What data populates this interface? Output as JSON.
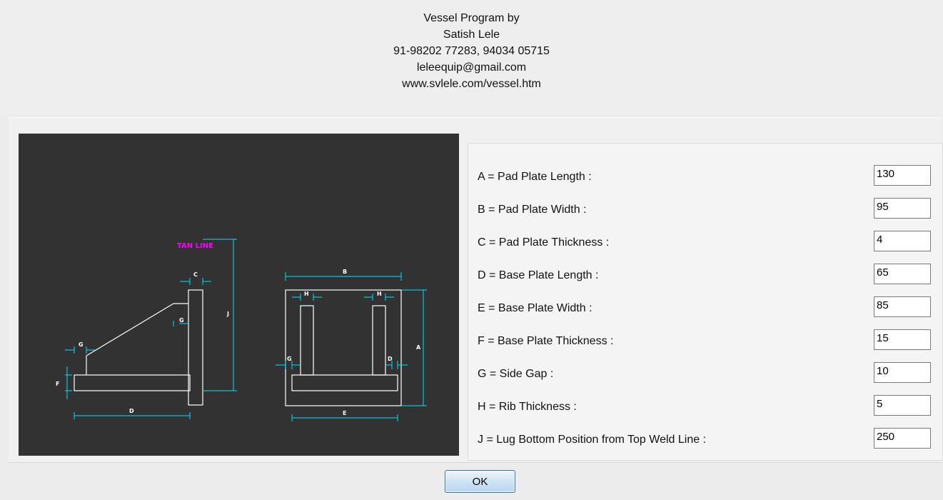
{
  "header": {
    "lines": [
      "Vessel Program by",
      "Satish Lele",
      "91-98202 77283, 94034 05715",
      "leleequip@gmail.com",
      "www.svlele.com/vessel.htm"
    ]
  },
  "drawing": {
    "tan_line_label": "TAN LINE",
    "dim_labels": {
      "A": "A",
      "B": "B",
      "C": "C",
      "D": "D",
      "E": "E",
      "F": "F",
      "G": "G",
      "H": "H",
      "J": "J"
    },
    "colors": {
      "background": "#323232",
      "outline": "#ffffff",
      "dimension": "#00e0ff",
      "tan_line": "#ff00ff"
    }
  },
  "parameters": [
    {
      "label": "A = Pad Plate Length :",
      "value": "130"
    },
    {
      "label": "B = Pad Plate Width :",
      "value": "95"
    },
    {
      "label": "C = Pad Plate Thickness :",
      "value": "4"
    },
    {
      "label": "D = Base Plate Length :",
      "value": "65"
    },
    {
      "label": "E = Base Plate Width :",
      "value": "85"
    },
    {
      "label": "F = Base Plate Thickness :",
      "value": "15"
    },
    {
      "label": "G = Side Gap :",
      "value": "10"
    },
    {
      "label": "H = Rib Thickness :",
      "value": "5"
    },
    {
      "label": "J = Lug Bottom Position from Top Weld Line :",
      "value": "250"
    }
  ],
  "buttons": {
    "ok_label": "OK"
  }
}
